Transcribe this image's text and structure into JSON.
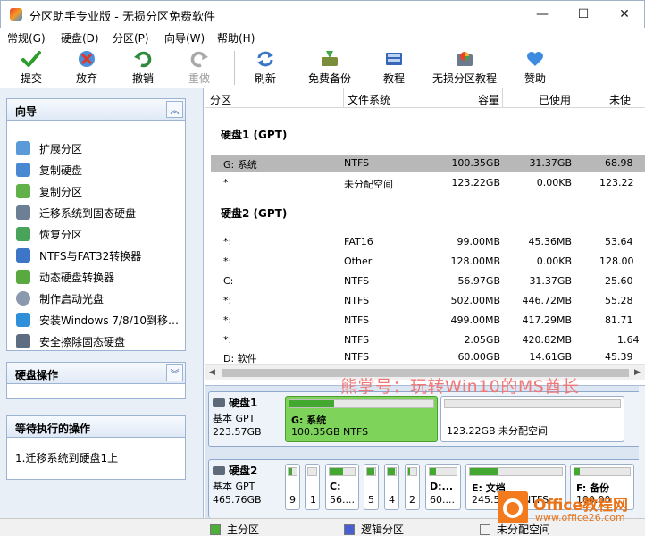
{
  "window": {
    "title": "分区助手专业版 - 无损分区免费软件",
    "minimize": "—",
    "maximize": "☐",
    "close": "✕"
  },
  "menu": [
    "常规(G)",
    "硬盘(D)",
    "分区(P)",
    "向导(W)",
    "帮助(H)"
  ],
  "toolbar": {
    "submit": "提交",
    "discard": "放弃",
    "undo": "撤销",
    "redo": "重做",
    "refresh": "刷新",
    "backup": "免费备份",
    "tutorial": "教程",
    "partition_tutorial": "无损分区教程",
    "donate": "赞助"
  },
  "wizard": {
    "title": "向导",
    "items": [
      "扩展分区",
      "复制硬盘",
      "复制分区",
      "迁移系统到固态硬盘",
      "恢复分区",
      "NTFS与FAT32转换器",
      "动态硬盘转换器",
      "制作启动光盘",
      "安装Windows 7/8/10到移…",
      "安全擦除固态硬盘"
    ]
  },
  "disk_ops": {
    "title": "硬盘操作"
  },
  "pending": {
    "title": "等待执行的操作",
    "items": [
      "1.迁移系统到硬盘1上"
    ]
  },
  "table": {
    "columns": [
      "分区",
      "文件系统",
      "容量",
      "已使用",
      "未使"
    ],
    "disk1": {
      "header": "硬盘1 (GPT)",
      "rows": [
        {
          "name": "G: 系统",
          "fs": "NTFS",
          "cap": "100.35GB",
          "used": "31.37GB",
          "free": "68.98"
        },
        {
          "name": "*",
          "fs": "未分配空间",
          "cap": "123.22GB",
          "used": "0.00KB",
          "free": "123.22"
        }
      ]
    },
    "disk2": {
      "header": "硬盘2 (GPT)",
      "rows": [
        {
          "name": "*:",
          "fs": "FAT16",
          "cap": "99.00MB",
          "used": "45.36MB",
          "free": "53.64"
        },
        {
          "name": "*:",
          "fs": "Other",
          "cap": "128.00MB",
          "used": "0.00KB",
          "free": "128.00"
        },
        {
          "name": "C:",
          "fs": "NTFS",
          "cap": "56.97GB",
          "used": "31.37GB",
          "free": "25.60"
        },
        {
          "name": "*:",
          "fs": "NTFS",
          "cap": "502.00MB",
          "used": "446.72MB",
          "free": "55.28"
        },
        {
          "name": "*:",
          "fs": "NTFS",
          "cap": "499.00MB",
          "used": "417.29MB",
          "free": "81.71"
        },
        {
          "name": "*:",
          "fs": "NTFS",
          "cap": "2.05GB",
          "used": "420.82MB",
          "free": "1.64"
        },
        {
          "name": "D: 软件",
          "fs": "NTFS",
          "cap": "60.00GB",
          "used": "14.61GB",
          "free": "45.39"
        }
      ]
    }
  },
  "watermark": "熊掌号：玩转Win10的MS酋长",
  "diskmap": {
    "disk1": {
      "name": "硬盘1",
      "type": "基本 GPT",
      "size": "223.57GB",
      "parts": [
        {
          "name": "G: 系统",
          "info": "100.35GB NTFS",
          "fill": 0.31
        },
        {
          "name": "",
          "info": "123.22GB 未分配空间",
          "fill": 0
        }
      ]
    },
    "disk2": {
      "name": "硬盘2",
      "type": "基本 GPT",
      "size": "465.76GB",
      "parts": [
        {
          "name": "",
          "info": "9",
          "fill": 0.46
        },
        {
          "name": "",
          "info": "1",
          "fill": 0.0
        },
        {
          "name": "C:",
          "info": "56....",
          "fill": 0.55
        },
        {
          "name": "",
          "info": "5",
          "fill": 0.89
        },
        {
          "name": "",
          "info": "4",
          "fill": 0.84
        },
        {
          "name": "",
          "info": "2",
          "fill": 0.2
        },
        {
          "name": "D:...",
          "info": "60....",
          "fill": 0.24
        },
        {
          "name": "E: 文档",
          "info": "245.54GB NTFS",
          "fill": 0.3
        },
        {
          "name": "F: 备份",
          "info": "100.00",
          "fill": 0.1
        }
      ]
    }
  },
  "legend": {
    "primary": "主分区",
    "logical": "逻辑分区",
    "unallocated": "未分配空间",
    "colors": {
      "primary": "#4caf3a",
      "logical": "#4a5fcf",
      "unallocated": "#f2f2f2"
    }
  },
  "brand": {
    "name": "Office教程网",
    "url": "www.office26.com"
  }
}
